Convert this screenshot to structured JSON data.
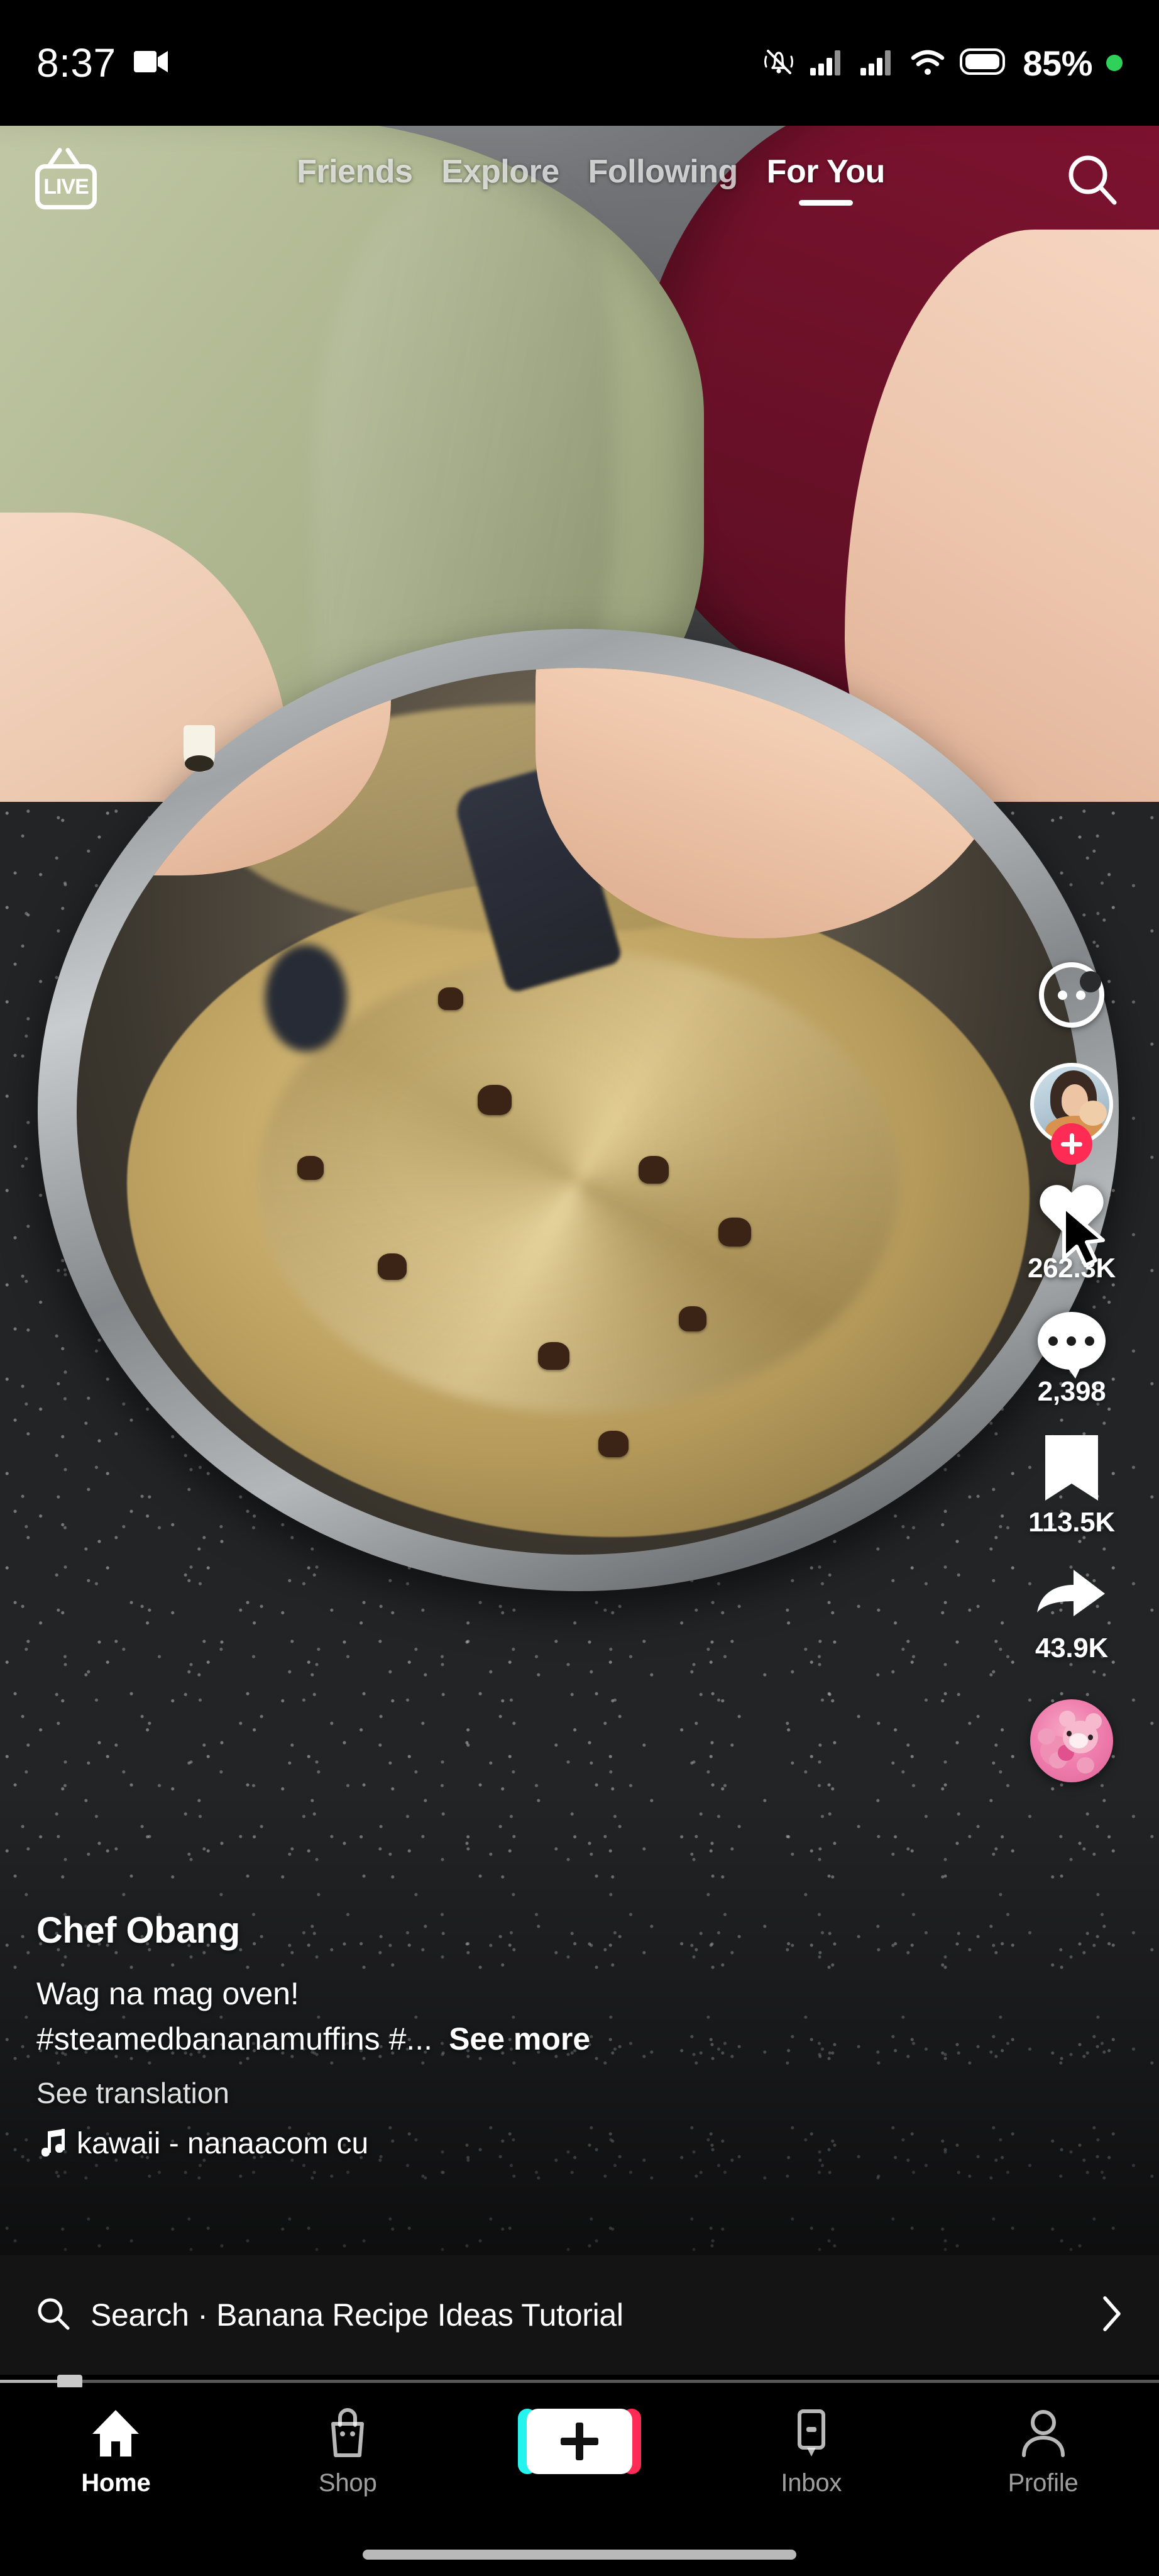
{
  "status_bar": {
    "time": "8:37",
    "battery_percent": "85%",
    "icons": [
      "screen-record-icon",
      "silent-mode-icon",
      "signal-sim1-icon",
      "signal-sim2-icon",
      "wifi-icon",
      "battery-icon",
      "recording-dot-icon"
    ]
  },
  "top_nav": {
    "live_label": "LIVE",
    "tabs": [
      {
        "label": "Friends",
        "active": false
      },
      {
        "label": "Explore",
        "active": false
      },
      {
        "label": "Following",
        "active": false
      },
      {
        "label": "For You",
        "active": true
      }
    ],
    "search_icon": "search-icon"
  },
  "action_rail": {
    "chat_icon": "chat-bubble-icon",
    "follow_icon": "plus-icon",
    "like": {
      "icon": "heart-icon",
      "count": "262.3K"
    },
    "comment": {
      "icon": "comment-icon",
      "count": "2,398"
    },
    "bookmark": {
      "icon": "bookmark-icon",
      "count": "113.5K"
    },
    "share": {
      "icon": "share-arrow-icon",
      "count": "43.9K"
    },
    "music_disc_icon": "music-disc-icon"
  },
  "caption": {
    "author": "Chef Obang",
    "line1": "Wag na mag oven!",
    "hashtags": "#steamedbananamuffins #...",
    "see_more": "See more",
    "see_translation": "See translation",
    "music_note_icon": "music-note-icon",
    "music_text": "kawaii - nanaacom  cu"
  },
  "search_suggestion": {
    "icon": "search-icon",
    "text": "Search · Banana Recipe Ideas Tutorial",
    "chevron_icon": "chevron-right-icon"
  },
  "scrubber": {
    "progress_percent": 6
  },
  "bottom_nav": {
    "items": [
      {
        "label": "Home",
        "icon": "home-icon",
        "active": true
      },
      {
        "label": "Shop",
        "icon": "shopping-bag-icon",
        "active": false
      },
      {
        "label": "",
        "icon": "create-plus-icon",
        "active": false
      },
      {
        "label": "Inbox",
        "icon": "inbox-icon",
        "active": false
      },
      {
        "label": "Profile",
        "icon": "person-icon",
        "active": false
      }
    ]
  },
  "colors": {
    "brand_pink": "#FE2C55",
    "brand_cyan": "#25F4EE",
    "battery_dot_green": "#30D158",
    "nav_background": "#000000",
    "search_bar_background": "#141414"
  }
}
